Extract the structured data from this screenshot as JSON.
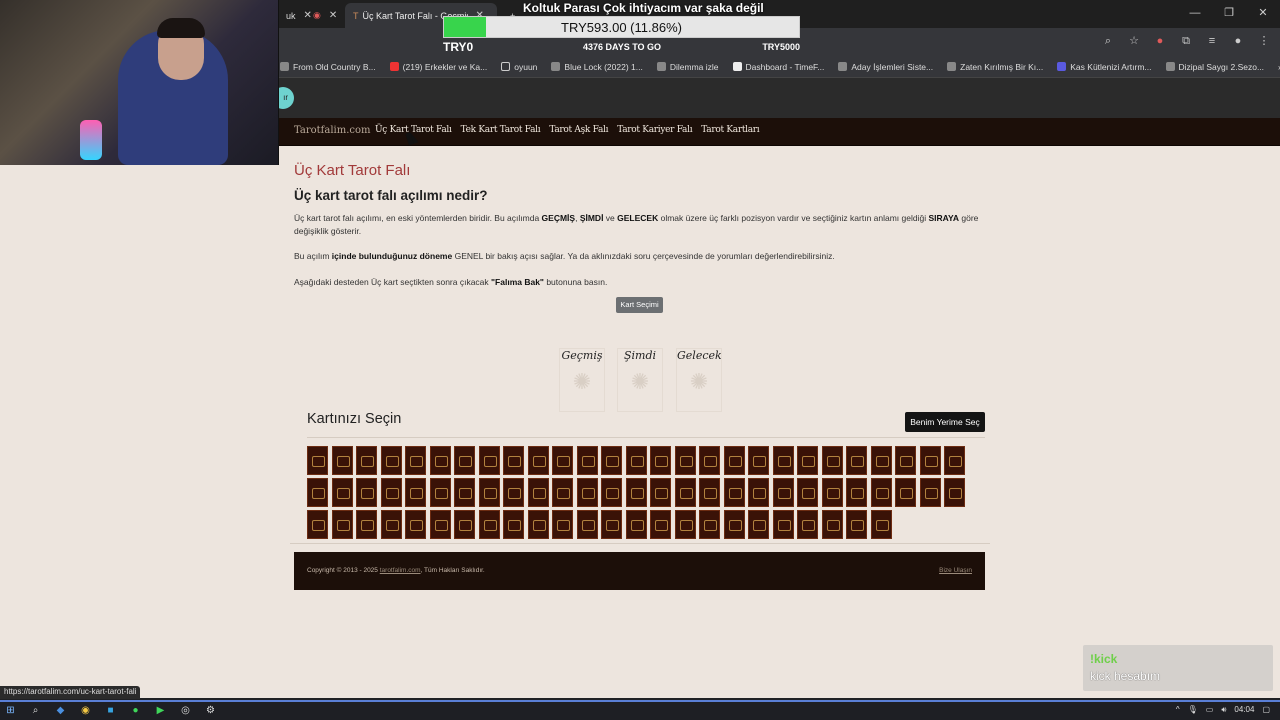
{
  "browser": {
    "tabs": [
      {
        "label": "uk",
        "active": false
      },
      {
        "label": "",
        "active": false
      },
      {
        "label": "Üç Kart Tarot Falı - Geçmiş",
        "active": true
      }
    ],
    "bookmarks": [
      "From Old Country B...",
      "(219) Erkekler ve Ka...",
      "oyuun",
      "Blue Lock (2022) 1...",
      "Dilemma izle",
      "Dashboard - TimeF...",
      "Aday İşlemleri Siste...",
      "Zaten Kırılmış Bir Kı...",
      "Kas Kütlenizi Artırm...",
      "Dizipal Saygı 2.Sezo..."
    ],
    "status_url": "https://tarotfalim.com/uc-kart-tarot-fali"
  },
  "overlay": {
    "donation": {
      "title": "Koltuk Parası Çok ihtiyacım var şaka değil",
      "amount": "TRY593.00 (11.86%)",
      "progress": 0.1186,
      "min": "TRY0",
      "days": "4376 DAYS TO GO",
      "max": "TRY5000"
    },
    "kick": {
      "command": "!kick",
      "message": "kick hesabım"
    },
    "chip_text": "ır"
  },
  "site": {
    "logo": "Tarotfalim.com",
    "nav": [
      "Üç Kart Tarot Falı",
      "Tek Kart Tarot Falı",
      "Tarot Aşk Falı",
      "Tarot Kariyer Falı",
      "Tarot Kartları"
    ],
    "page_title": "Üç Kart Tarot Falı",
    "question": "Üç kart tarot falı açılımı nedir?",
    "p1": {
      "t1": "Üç kart tarot falı açılımı, en eski yöntemlerden biridir. Bu açılımda ",
      "b1": "GEÇMİŞ",
      "t2": ", ",
      "b2": "ŞİMDİ",
      "t3": " ve ",
      "b3": "GELECEK",
      "t4": " olmak üzere üç farklı pozisyon vardır ve seçtiğiniz kartın anlamı geldiği ",
      "b4": "SIRAYA",
      "t5": " göre değişiklik gösterir."
    },
    "p2": {
      "t1": "Bu açılım ",
      "b1": "içinde bulunduğunuz döneme",
      "t2": " GENEL bir bakış açısı sağlar. Ya da aklınızdaki soru çerçevesinde de yorumları değerlendirebilirsiniz."
    },
    "p3": {
      "t1": "Aşağıdaki desteden Üç kart seçtikten sonra çıkacak ",
      "b1": "\"Falıma Bak\"",
      "t2": " butonuna basın."
    },
    "kart_secimi": "Kart Seçimi",
    "slots": [
      "Geçmiş",
      "Şimdi",
      "Gelecek"
    ],
    "choose_title": "Kartınızı Seçin",
    "pick_for_me": "Benim Yerime Seç",
    "card_rows": [
      27,
      27,
      24
    ],
    "footer": {
      "copyright_pre": "Copyright © 2013 - 2025 ",
      "copyright_link": "tarotfalim.com",
      "copyright_post": ", Tüm Hakları Saklıdır.",
      "contact": "Bize Ulaşın"
    }
  },
  "taskbar": {
    "time": "04:04"
  }
}
